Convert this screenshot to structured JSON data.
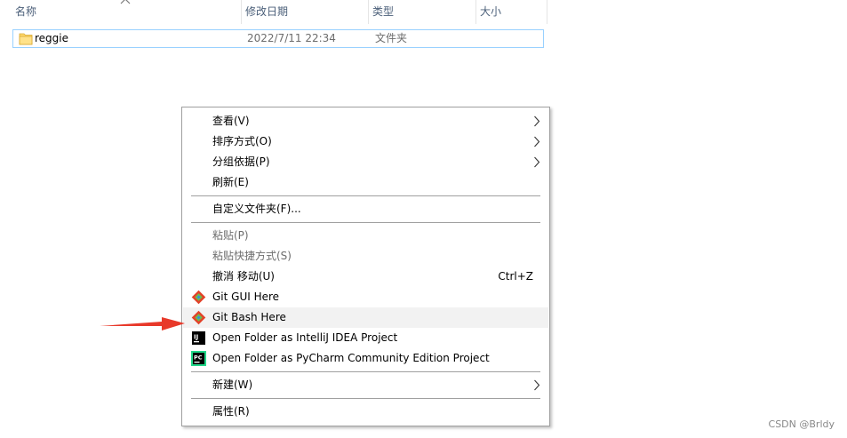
{
  "columns": {
    "name": "名称",
    "date_modified": "修改日期",
    "type": "类型",
    "size": "大小"
  },
  "file": {
    "name": "reggie",
    "date": "2022/7/11 22:34",
    "type": "文件夹",
    "icon": "folder-icon"
  },
  "menu": {
    "view": "查看(V)",
    "sort_by": "排序方式(O)",
    "group_by": "分组依据(P)",
    "refresh": "刷新(E)",
    "customize_folder": "自定义文件夹(F)...",
    "paste": "粘贴(P)",
    "paste_shortcut": "粘贴快捷方式(S)",
    "undo_move": "撤消 移动(U)",
    "undo_shortcut": "Ctrl+Z",
    "git_gui": "Git GUI Here",
    "git_bash": "Git Bash Here",
    "intellij": "Open Folder as IntelliJ IDEA Project",
    "pycharm": "Open Folder as PyCharm Community Edition Project",
    "new": "新建(W)",
    "properties": "属性(R)"
  },
  "icons": {
    "intellij_text": "IJ",
    "pycharm_text": "PC"
  },
  "colors": {
    "selection_border": "#99d1ff",
    "arrow_red": "#e8392a",
    "folder_yellow": "#ffd86b"
  },
  "watermark": "CSDN @Brldy"
}
